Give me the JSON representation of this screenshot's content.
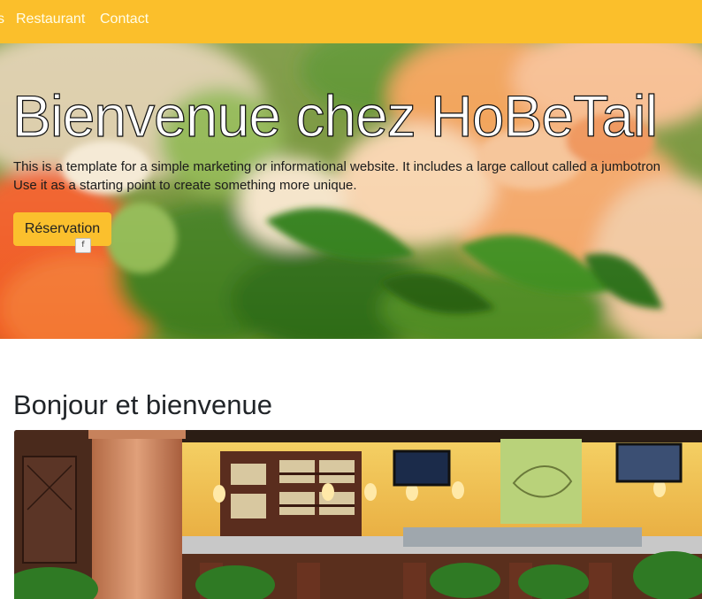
{
  "nav": {
    "partial_item": "s",
    "items": [
      {
        "label": "Restaurant"
      },
      {
        "label": "Contact"
      }
    ]
  },
  "hero": {
    "title": "Bienvenue chez HoBeTail",
    "lead_line1": "This is a template for a simple marketing or informational website. It includes a large callout called a jumbotron",
    "lead_line2": "Use it as a starting point to create something more unique.",
    "button_label": "Réservation",
    "fb_icon_glyph": "f"
  },
  "main": {
    "section_title": "Bonjour et bienvenue"
  },
  "colors": {
    "navbar": "#fbbf2b",
    "button": "#fbc02d"
  }
}
